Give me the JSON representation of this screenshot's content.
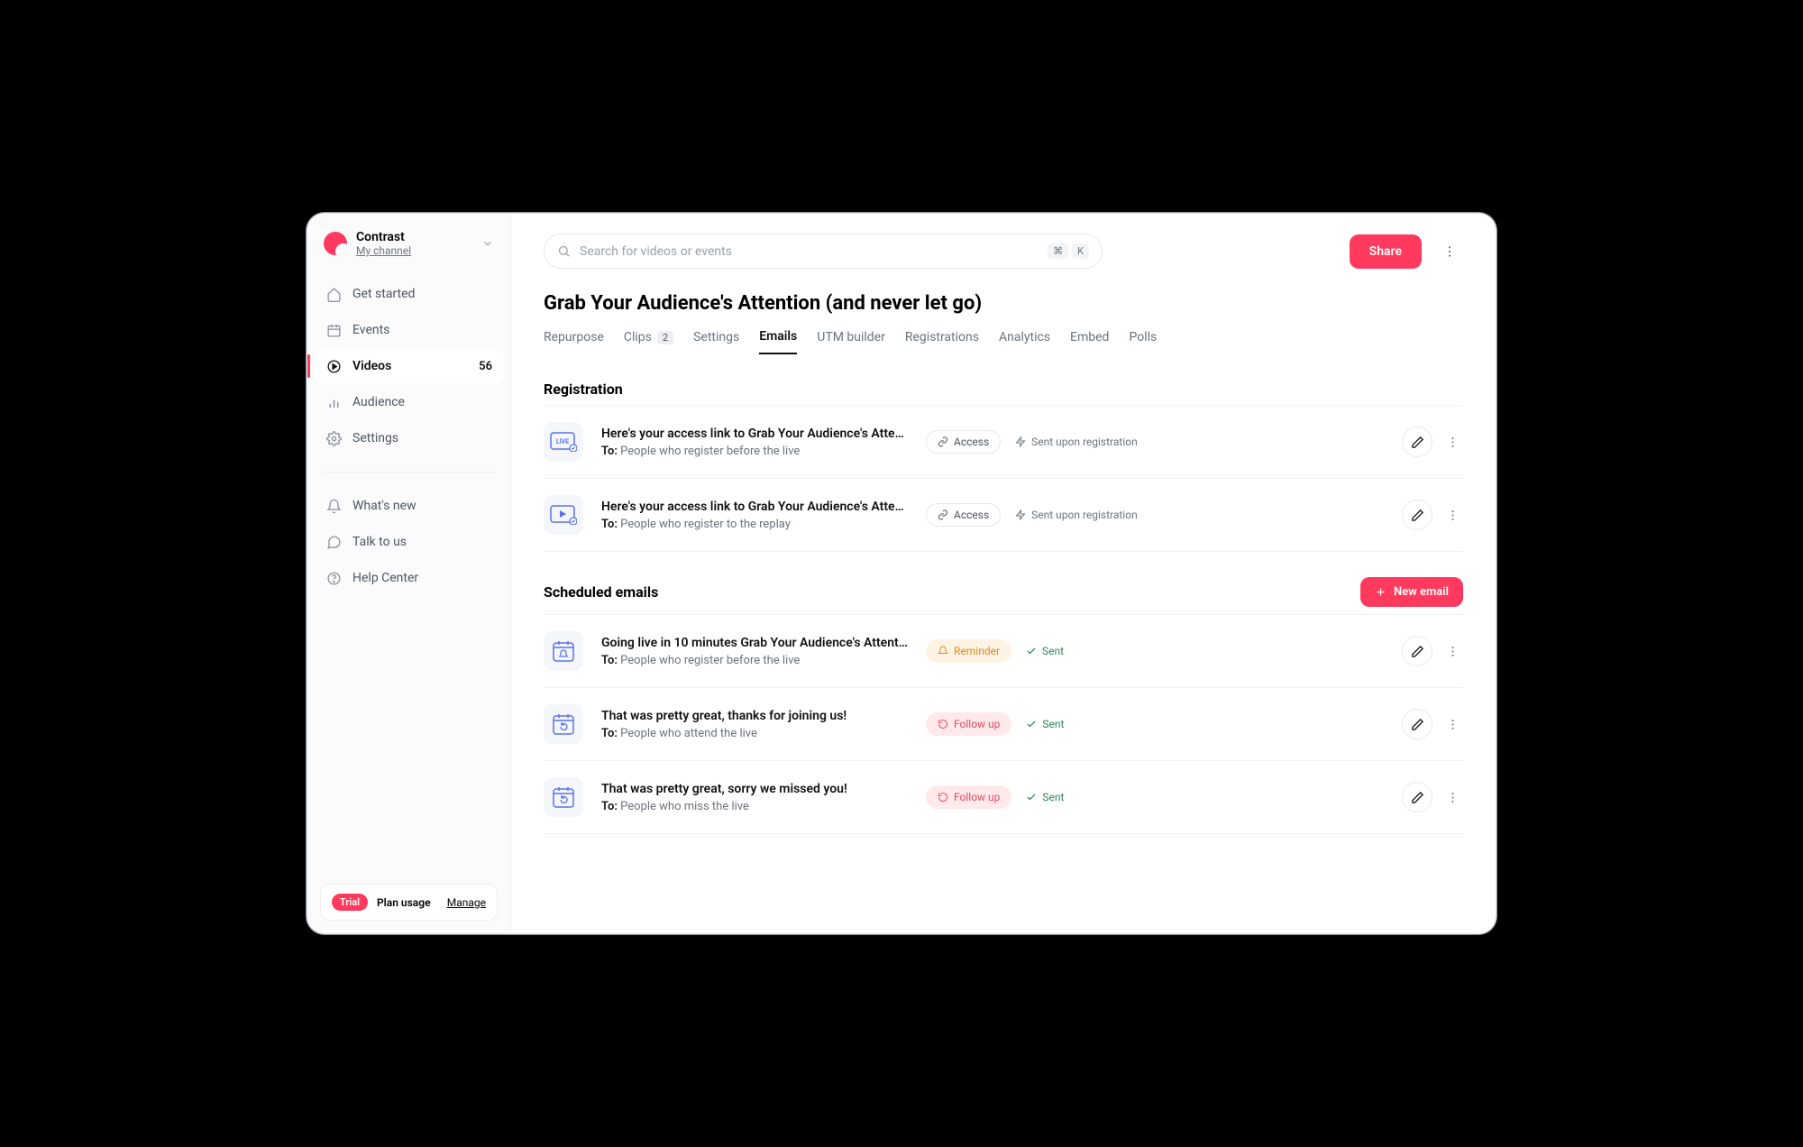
{
  "workspace": {
    "name": "Contrast",
    "subtitle": "My channel"
  },
  "nav": {
    "items": [
      {
        "label": "Get started",
        "icon": "home"
      },
      {
        "label": "Events",
        "icon": "calendar"
      },
      {
        "label": "Videos",
        "icon": "play",
        "count": "56",
        "active": true
      },
      {
        "label": "Audience",
        "icon": "bars"
      },
      {
        "label": "Settings",
        "icon": "gear"
      }
    ],
    "footer": [
      {
        "label": "What's new",
        "icon": "bell"
      },
      {
        "label": "Talk to us",
        "icon": "chat"
      },
      {
        "label": "Help Center",
        "icon": "help"
      }
    ]
  },
  "plan": {
    "badge": "Trial",
    "label": "Plan usage",
    "manage": "Manage"
  },
  "search": {
    "placeholder": "Search for videos or events",
    "kbd1": "⌘",
    "kbd2": "K"
  },
  "header": {
    "share": "Share"
  },
  "page": {
    "title": "Grab Your Audience's Attention (and never let go)"
  },
  "tabs": [
    {
      "label": "Repurpose"
    },
    {
      "label": "Clips",
      "badge": "2"
    },
    {
      "label": "Settings"
    },
    {
      "label": "Emails",
      "active": true
    },
    {
      "label": "UTM builder"
    },
    {
      "label": "Registrations"
    },
    {
      "label": "Analytics"
    },
    {
      "label": "Embed"
    },
    {
      "label": "Polls"
    }
  ],
  "sections": {
    "registration": {
      "title": "Registration",
      "rows": [
        {
          "icon": "live",
          "title": "Here's your access link to Grab Your Audience's Attention...",
          "to": "People who register before the live",
          "badge": {
            "type": "access",
            "text": "Access"
          },
          "meta": {
            "icon": "bolt",
            "text": "Sent upon registration"
          }
        },
        {
          "icon": "replay",
          "title": "Here's your access link to Grab Your Audience's Attention...",
          "to": "People who register to the replay",
          "badge": {
            "type": "access",
            "text": "Access"
          },
          "meta": {
            "icon": "bolt",
            "text": "Sent upon registration"
          }
        }
      ]
    },
    "scheduled": {
      "title": "Scheduled emails",
      "new_btn": "New email",
      "rows": [
        {
          "icon": "cal-bell",
          "title": "Going live in 10 minutes Grab Your Audience's Attention...",
          "to": "People who register before the live",
          "badge": {
            "type": "reminder",
            "text": "Reminder"
          },
          "meta": {
            "icon": "check",
            "text": "Sent",
            "sent": true
          }
        },
        {
          "icon": "cal-back",
          "title": "That was pretty great, thanks for joining us!",
          "to": "People who attend the live",
          "badge": {
            "type": "followup",
            "text": "Follow up"
          },
          "meta": {
            "icon": "check",
            "text": "Sent",
            "sent": true
          }
        },
        {
          "icon": "cal-back",
          "title": "That was pretty great, sorry we missed you!",
          "to": "People who miss the live",
          "badge": {
            "type": "followup",
            "text": "Follow up"
          },
          "meta": {
            "icon": "check",
            "text": "Sent",
            "sent": true
          }
        }
      ]
    }
  },
  "to_label": "To:"
}
